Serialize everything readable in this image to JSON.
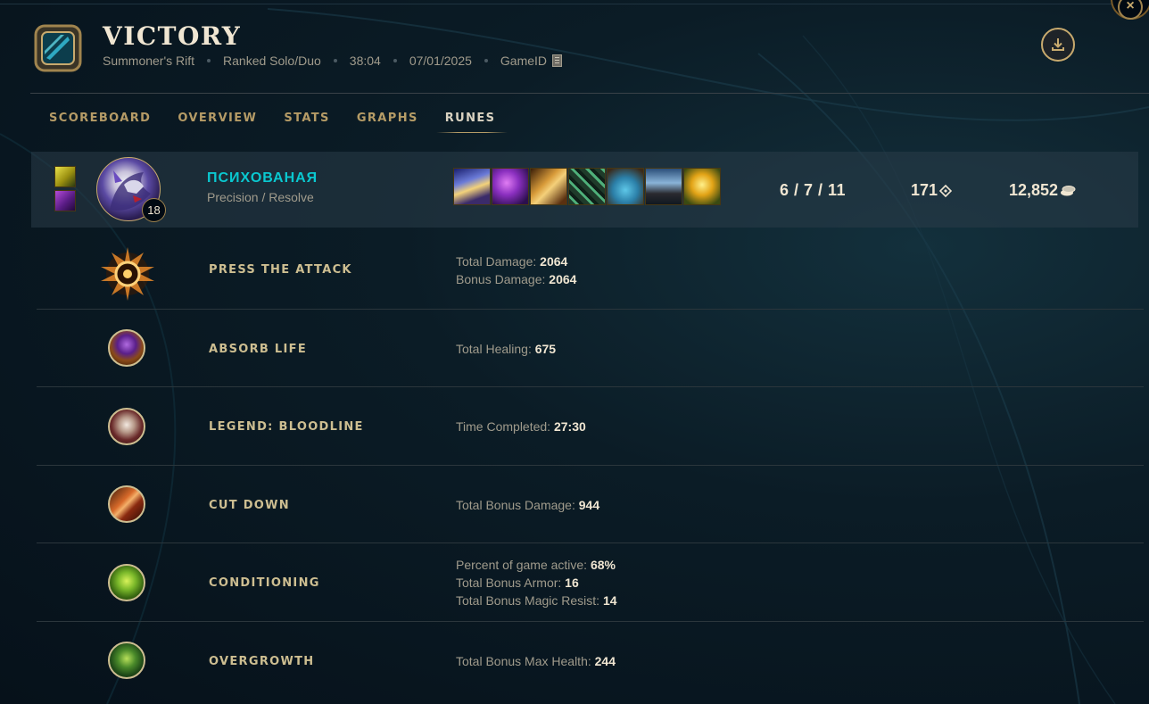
{
  "header": {
    "title": "VICTORY",
    "map": "Summoner's Rift",
    "queue": "Ranked Solo/Duo",
    "duration": "38:04",
    "date": "07/01/2025",
    "game_id_label": "GameID"
  },
  "tabs": [
    {
      "label": "SCOREBOARD",
      "active": false
    },
    {
      "label": "OVERVIEW",
      "active": false
    },
    {
      "label": "STATS",
      "active": false
    },
    {
      "label": "GRAPHS",
      "active": false
    },
    {
      "label": "RUNES",
      "active": true
    }
  ],
  "player": {
    "name": "ПСИХОВАНАЯ",
    "rune_paths": "Precision / Resolve",
    "level": "18",
    "kda": "6 / 7 / 11",
    "cs": "171",
    "gold": "12,852",
    "summoner_spells": [
      "ghost-spell-icon",
      "teleport-spell-icon"
    ],
    "items": [
      "item-1-icon",
      "item-2-icon",
      "item-3-icon",
      "item-4-icon",
      "item-5-icon",
      "item-6-icon",
      "trinket-icon"
    ]
  },
  "runes": [
    {
      "name": "PRESS THE ATTACK",
      "icon": "press-the-attack-icon",
      "stats": [
        {
          "label": "Total Damage:",
          "value": "2064"
        },
        {
          "label": "Bonus Damage:",
          "value": "2064"
        }
      ]
    },
    {
      "name": "ABSORB LIFE",
      "icon": "absorb-life-icon",
      "stats": [
        {
          "label": "Total Healing:",
          "value": "675"
        }
      ]
    },
    {
      "name": "LEGEND: BLOODLINE",
      "icon": "legend-bloodline-icon",
      "stats": [
        {
          "label": "Time Completed:",
          "value": "27:30"
        }
      ]
    },
    {
      "name": "CUT DOWN",
      "icon": "cut-down-icon",
      "stats": [
        {
          "label": "Total Bonus Damage:",
          "value": "944"
        }
      ]
    },
    {
      "name": "CONDITIONING",
      "icon": "conditioning-icon",
      "stats": [
        {
          "label": "Percent of game active:",
          "value": "68%"
        },
        {
          "label": "Total Bonus Armor:",
          "value": "16"
        },
        {
          "label": "Total Bonus Magic Resist:",
          "value": "14"
        }
      ]
    },
    {
      "name": "OVERGROWTH",
      "icon": "overgrowth-icon",
      "stats": [
        {
          "label": "Total Bonus Max Health:",
          "value": "244"
        }
      ]
    }
  ],
  "colors": {
    "gold": "#c8aa6e",
    "title": "#f0e6d2",
    "player_name": "#0ac8d0",
    "muted": "#a09b8c",
    "row_highlight": "#293c48"
  }
}
